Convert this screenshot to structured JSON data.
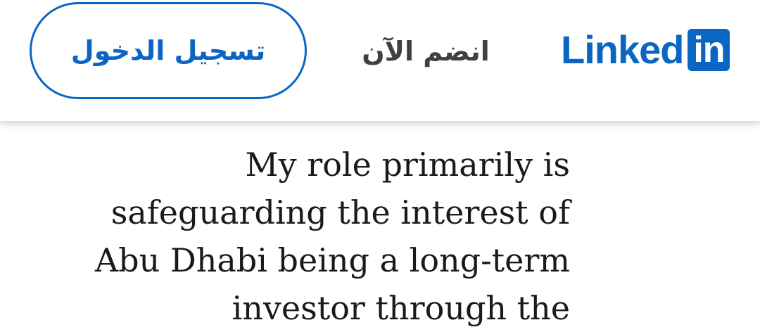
{
  "header": {
    "signin_label": "تسجيل الدخول",
    "join_label": "انضم الآن",
    "logo": {
      "word": "Linked",
      "box": "in"
    }
  },
  "article": {
    "lines": [
      "My role primarily is",
      "safeguarding the interest of",
      "Abu Dhabi being a long-term",
      "investor through the"
    ]
  },
  "colors": {
    "brand": "#0a66c2",
    "text": "#1a1a1a",
    "secondary_text": "#404040"
  }
}
